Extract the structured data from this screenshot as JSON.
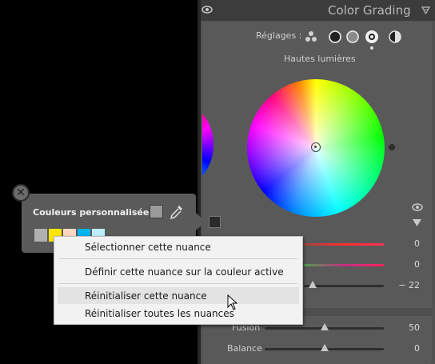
{
  "panel": {
    "title": "Color Grading",
    "reglages_label": "Réglages :",
    "wheel_label": "Hautes lumières",
    "values": [
      "0",
      "0",
      "− 22"
    ],
    "fusion_label": "Fusion",
    "fusion_value": "50",
    "balance_label": "Balance",
    "balance_value": "0"
  },
  "popup": {
    "title": "Couleurs personnalisées :",
    "close_glyph": "✕",
    "swatches": [
      "#b0b0b0",
      "#ffe600",
      "#ffd9c2",
      "#00b4f0",
      "#bfefff"
    ]
  },
  "menu": {
    "items": [
      "Sélectionner cette nuance",
      "Définir cette nuance sur la couleur active",
      "Réinitialiser cette nuance",
      "Réinitialiser toutes les nuances"
    ]
  },
  "colors": {
    "panel_bg": "#525252",
    "menu_bg": "#f2f2f2",
    "menu_hover": "#e3e3e3"
  }
}
